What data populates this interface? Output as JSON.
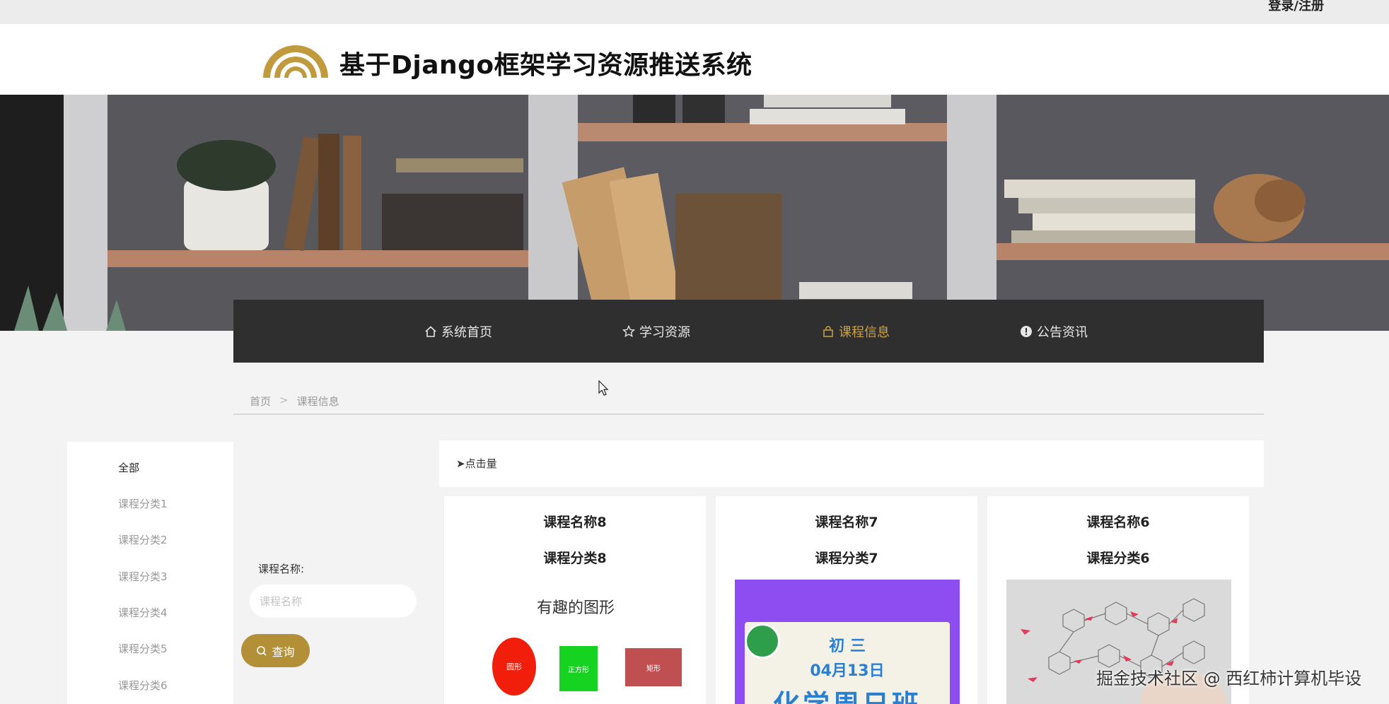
{
  "topbar": {
    "login_label": "登录/注册"
  },
  "header": {
    "title": "基于Django框架学习资源推送系统"
  },
  "nav": {
    "items": [
      {
        "label": "系统首页",
        "icon": "home-icon"
      },
      {
        "label": "学习资源",
        "icon": "star-icon"
      },
      {
        "label": "课程信息",
        "icon": "bag-icon",
        "active": true
      },
      {
        "label": "公告资讯",
        "icon": "info-icon"
      }
    ]
  },
  "breadcrumb": {
    "home": "首页",
    "sep": ">",
    "current": "课程信息"
  },
  "sidebar": {
    "items": [
      {
        "label": "全部",
        "active": true
      },
      {
        "label": "课程分类1"
      },
      {
        "label": "课程分类2"
      },
      {
        "label": "课程分类3"
      },
      {
        "label": "课程分类4"
      },
      {
        "label": "课程分类5"
      },
      {
        "label": "课程分类6"
      }
    ]
  },
  "search": {
    "label": "课程名称:",
    "placeholder": "课程名称",
    "button": "查询"
  },
  "sort": {
    "label": "➤点击量"
  },
  "cards": [
    {
      "name": "课程名称8",
      "category": "课程分类8",
      "image": {
        "heading": "有趣的图形",
        "shapes": [
          {
            "label": "圆形",
            "color": "#f01e0a"
          },
          {
            "label": "正方形",
            "color": "#16d321"
          },
          {
            "label": "矩形",
            "color": "#c04f51"
          }
        ]
      }
    },
    {
      "name": "课程名称7",
      "category": "课程分类7",
      "image": {
        "grade": "初 三",
        "date": "04月13日",
        "headline": "化学周日班",
        "bg": "#8d4df0"
      }
    },
    {
      "name": "课程名称6",
      "category": "课程分类6",
      "image": {
        "description": "chemical structure diagram"
      }
    }
  ],
  "watermark": "掘金技术社区 @ 西红柿计算机毕设",
  "colors": {
    "accent": "#c9a246",
    "nav_bg": "#2f2f2f",
    "button": "#b39037"
  }
}
